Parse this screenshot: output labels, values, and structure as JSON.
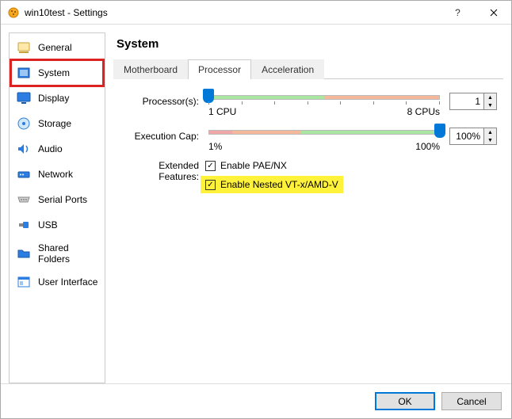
{
  "window": {
    "title": "win10test - Settings"
  },
  "sidebar": {
    "items": [
      {
        "label": "General"
      },
      {
        "label": "System"
      },
      {
        "label": "Display"
      },
      {
        "label": "Storage"
      },
      {
        "label": "Audio"
      },
      {
        "label": "Network"
      },
      {
        "label": "Serial Ports"
      },
      {
        "label": "USB"
      },
      {
        "label": "Shared Folders"
      },
      {
        "label": "User Interface"
      }
    ],
    "selected_index": 1
  },
  "main": {
    "heading": "System",
    "tabs": [
      {
        "label": "Motherboard"
      },
      {
        "label": "Processor"
      },
      {
        "label": "Acceleration"
      }
    ],
    "active_tab_index": 1,
    "processor": {
      "processors_label": "Processor(s):",
      "processors_value": "1",
      "processors_min_label": "1 CPU",
      "processors_max_label": "8 CPUs",
      "exec_cap_label": "Execution Cap:",
      "exec_cap_value": "100%",
      "exec_cap_min_label": "1%",
      "exec_cap_max_label": "100%",
      "extended_label": "Extended Features:",
      "pae_label": "Enable PAE/NX",
      "pae_checked": true,
      "nested_label": "Enable Nested VT-x/AMD-V",
      "nested_checked": true
    }
  },
  "footer": {
    "ok": "OK",
    "cancel": "Cancel"
  }
}
